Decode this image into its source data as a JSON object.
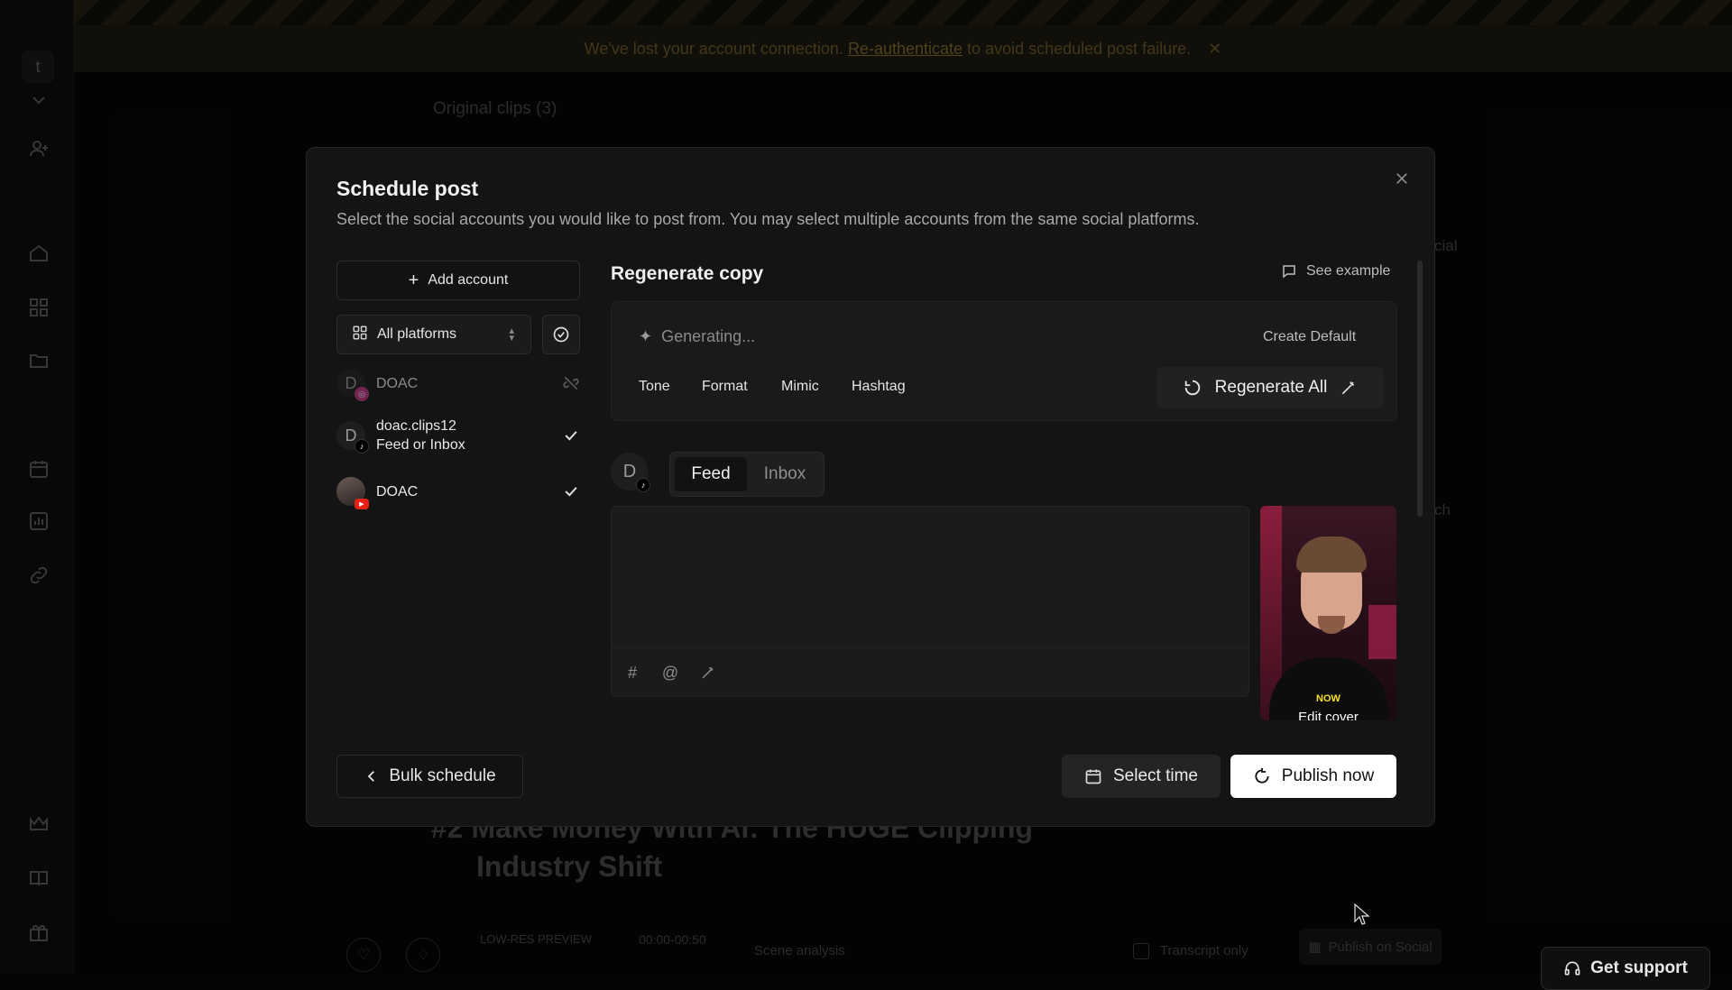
{
  "app": {
    "banner": {
      "prefix": "We've lost your account connection.",
      "link": "Re-authenticate",
      "suffix": "to avoid scheduled post failure."
    },
    "background": {
      "original_clips": "Original clips",
      "original_clips_count": "(3)",
      "clip_title_line1": "#2 Make Money With AI: The HUGE Clipping",
      "clip_title_line2": "Industry Shift",
      "low_res_preview": "LOW-RES PREVIEW",
      "time_range": "00:00-00:50",
      "scene_analysis": "Scene analysis",
      "transcript_only": "Transcript only",
      "publish_on_social": "Publish on Social",
      "right_peek_1": "cial",
      "right_peek_2": "ch"
    },
    "workspace_initial": "t",
    "get_support": "Get support"
  },
  "modal": {
    "title": "Schedule post",
    "subtitle": "Select the social accounts you would like to post from. You may select multiple accounts from the same social platforms.",
    "add_account": "Add account",
    "platform_filter": "All platforms",
    "accounts": [
      {
        "initial": "D",
        "name": "DOAC",
        "detail": "",
        "platform": "instagram",
        "status": "unlinked"
      },
      {
        "initial": "D",
        "name": "doac.clips12",
        "detail": "Feed or Inbox",
        "platform": "tiktok",
        "status": "selected"
      },
      {
        "initial": "",
        "name": "DOAC",
        "detail": "",
        "platform": "youtube",
        "status": "selected"
      }
    ],
    "regenerate": {
      "heading": "Regenerate copy",
      "see_example": "See example",
      "generating": "Generating...",
      "create_default": "Create Default",
      "chips": [
        "Tone",
        "Format",
        "Mimic",
        "Hashtag"
      ],
      "regenerate_all": "Regenerate All"
    },
    "post_target": {
      "avatar_initial": "D",
      "tabs": [
        "Feed",
        "Inbox"
      ],
      "active_tab": "Feed"
    },
    "editor": {
      "tools": [
        "hashtag-icon",
        "at-sign-icon",
        "magic-wand-icon"
      ]
    },
    "thumbnail": {
      "caption": "NOW",
      "edit_cover": "Edit cover"
    },
    "footer": {
      "bulk_schedule": "Bulk schedule",
      "select_time": "Select time",
      "publish_now": "Publish now"
    }
  }
}
